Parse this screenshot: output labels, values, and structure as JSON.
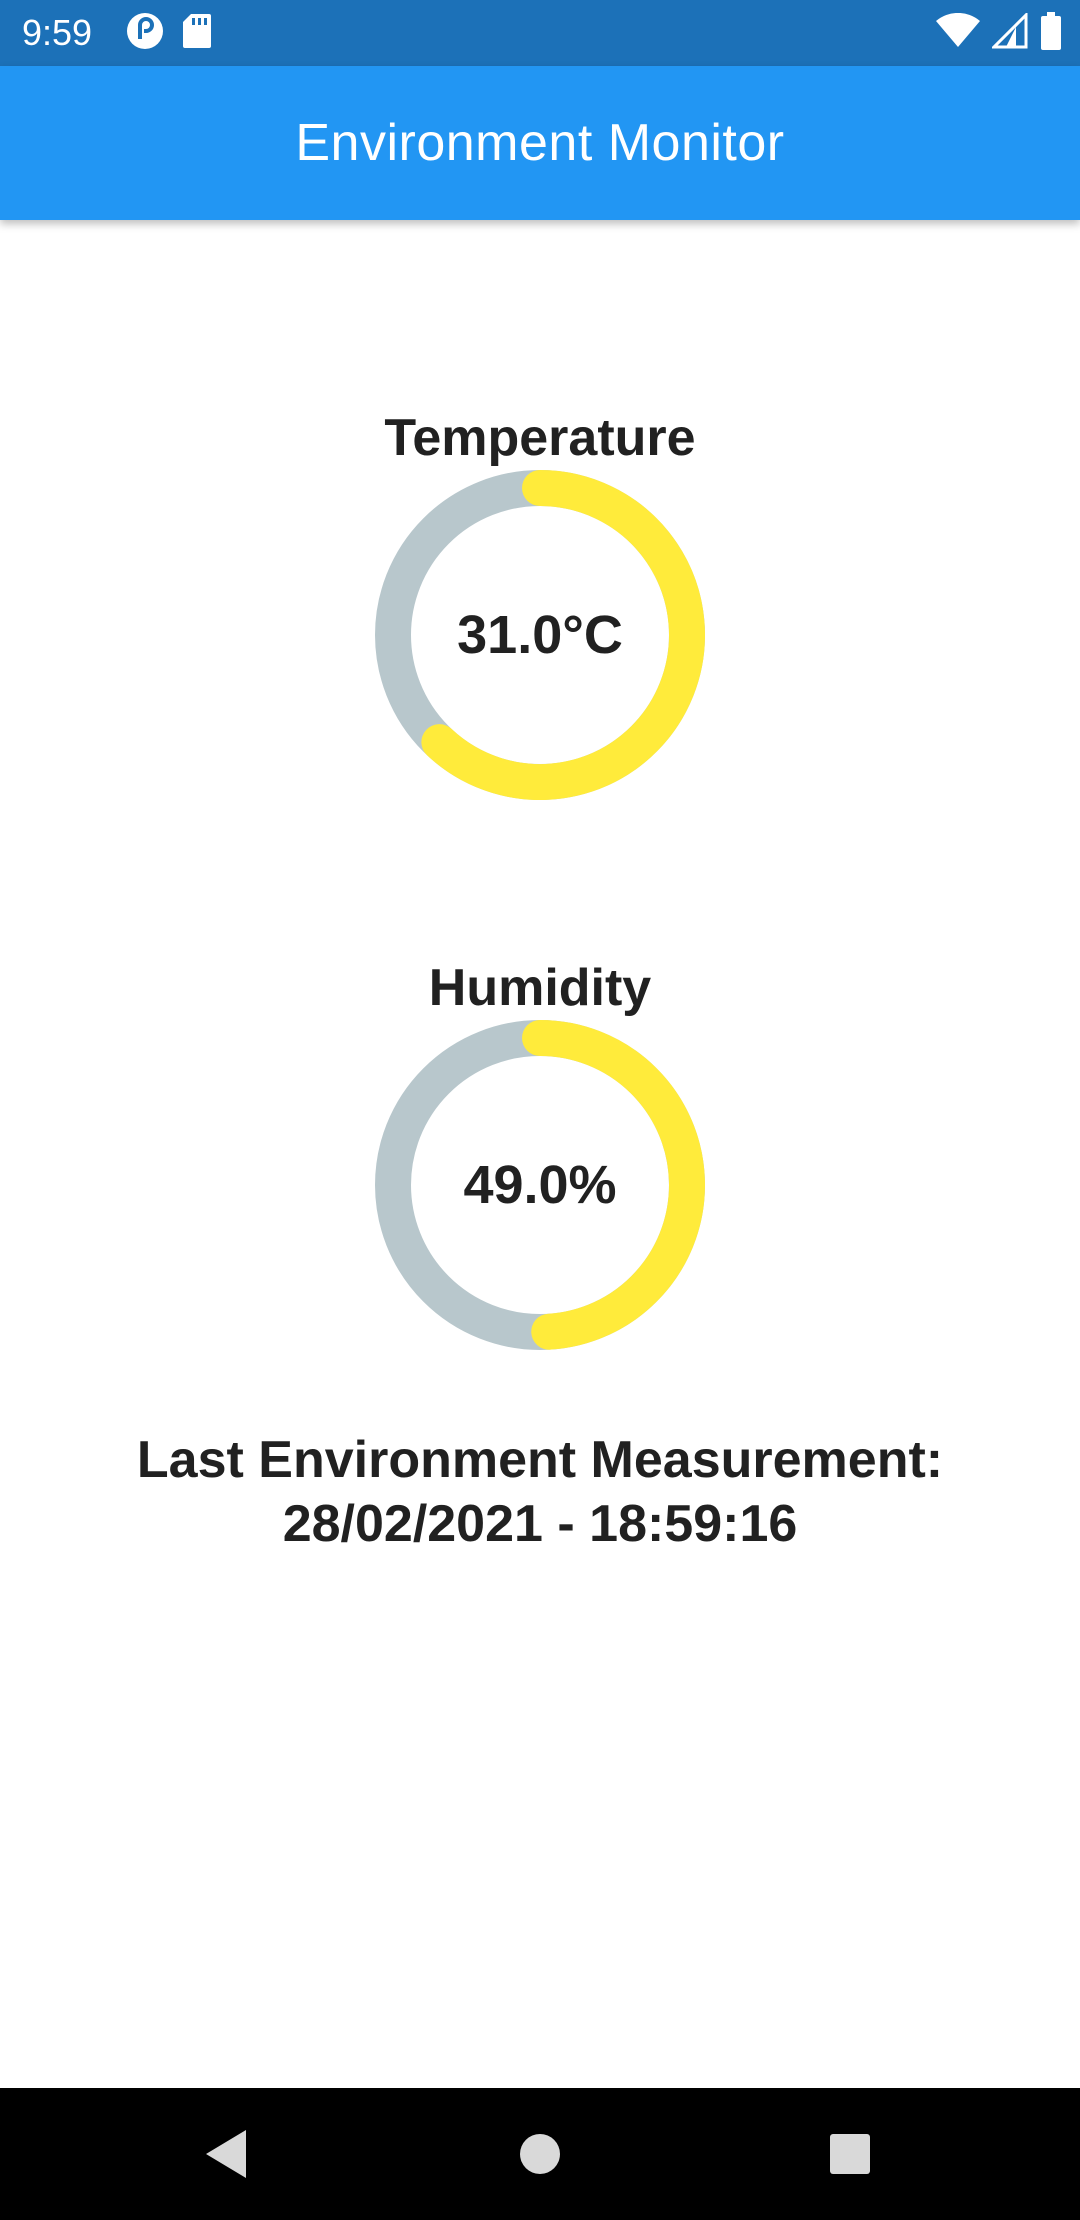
{
  "status_bar": {
    "time": "9:59",
    "left_icons": [
      "pocket-casts-icon",
      "sd-card-icon"
    ],
    "right_icons": [
      "wifi-icon",
      "signal-icon",
      "battery-icon"
    ]
  },
  "app_bar": {
    "title": "Environment Monitor"
  },
  "gauges": [
    {
      "label": "Temperature",
      "value_text": "31.0°C",
      "fraction": 0.62
    },
    {
      "label": "Humidity",
      "value_text": "49.0%",
      "fraction": 0.49
    }
  ],
  "measurement": {
    "line1": "Last Environment Measurement:",
    "line2": "28/02/2021 - 18:59:16"
  },
  "colors": {
    "status_bar": "#1c71b8",
    "app_bar": "#2296f3",
    "gauge_track": "#b8c7cc",
    "gauge_fill": "#ffeb3b",
    "text": "#212121"
  },
  "nav_bar": {
    "buttons": [
      "back-icon",
      "home-icon",
      "recents-icon"
    ]
  }
}
